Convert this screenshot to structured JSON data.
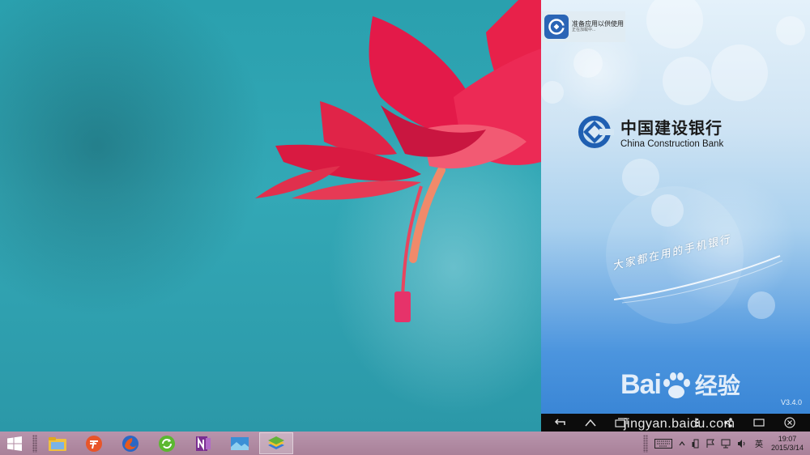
{
  "desktop": {
    "wallpaper": "red-flower-teal-background"
  },
  "emulator": {
    "notification": {
      "title": "准备应用以供使用",
      "subtitle": "正在加载中..."
    },
    "app": {
      "brand_cn": "中国建设银行",
      "brand_en": "China Construction Bank",
      "slogan": "大家都在用的手机银行",
      "version": "V3.4.0",
      "accent": "#2b65b6"
    },
    "navbar": [
      "back-icon",
      "home-icon",
      "recents-icon",
      "menu-icon",
      "share-icon",
      "screen-icon",
      "close-icon"
    ]
  },
  "watermark": {
    "brand": "Bai",
    "brand_cn": "经验",
    "url": "jingyan.baidu.com"
  },
  "taskbar": {
    "apps": [
      "file-explorer-icon",
      "xunlei-icon",
      "firefox-icon",
      "green-refresh-icon",
      "onenote-icon",
      "photo-icon",
      "bluestacks-icon"
    ],
    "active_app": "bluestacks-icon",
    "tray": {
      "ime": "英",
      "time": "19:07",
      "date": "2015/3/14"
    }
  }
}
